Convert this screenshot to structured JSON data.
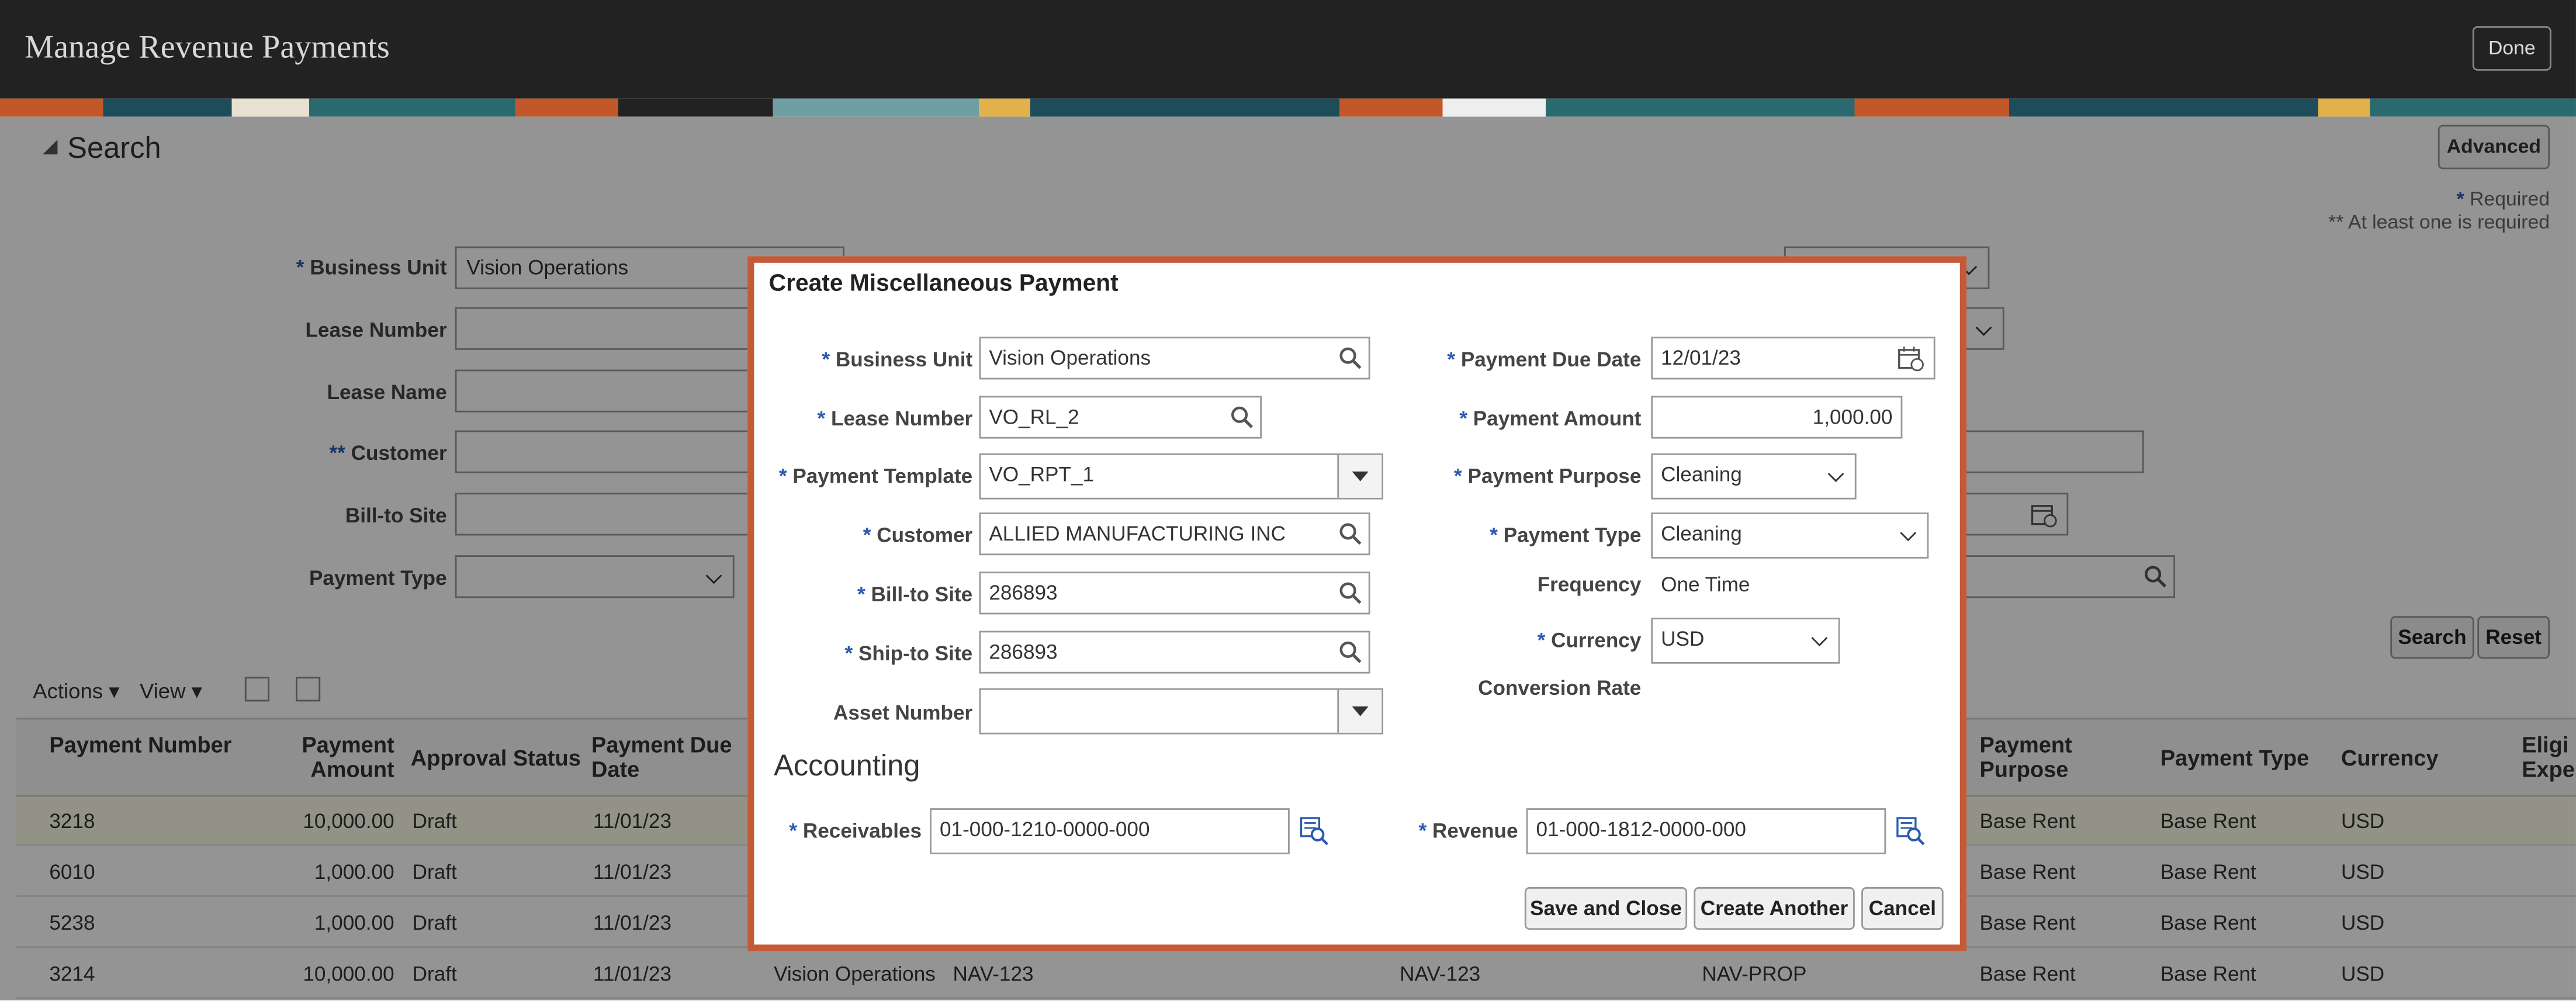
{
  "header": {
    "title": "Manage Revenue Payments",
    "done_label": "Done"
  },
  "search": {
    "title": "Search",
    "advanced_label": "Advanced",
    "required_note": "Required",
    "atleast_note": "** At least one is required",
    "fields": {
      "business_unit_label": "Business Unit",
      "business_unit_value": "Vision Operations",
      "lease_number_label": "Lease Number",
      "lease_name_label": "Lease Name",
      "customer_label": "Customer",
      "bill_to_site_label": "Bill-to Site",
      "payment_type_label": "Payment Type"
    },
    "search_label": "Search",
    "reset_label": "Reset"
  },
  "toolbar": {
    "actions_label": "Actions",
    "view_label": "View"
  },
  "table": {
    "columns": {
      "payment_number": "Payment Number",
      "payment_amount": "Payment Amount",
      "approval_status": "Approval Status",
      "payment_due_date": "Payment Due Date",
      "payment_purpose": "Payment Purpose",
      "payment_type": "Payment Type",
      "currency": "Currency",
      "eligible_expense": "Eligi Expe"
    },
    "rows": [
      {
        "number": "3218",
        "amount": "10,000.00",
        "status": "Draft",
        "due": "11/01/23",
        "bu": "",
        "lease": "",
        "lease2": "",
        "prop": "",
        "purpose": "Base Rent",
        "type": "Base Rent",
        "currency": "USD"
      },
      {
        "number": "6010",
        "amount": "1,000.00",
        "status": "Draft",
        "due": "11/01/23",
        "bu": "",
        "lease": "",
        "lease2": "",
        "prop": "",
        "purpose": "Base Rent",
        "type": "Base Rent",
        "currency": "USD"
      },
      {
        "number": "5238",
        "amount": "1,000.00",
        "status": "Draft",
        "due": "11/01/23",
        "bu": "",
        "lease": "",
        "lease2": "",
        "prop": "",
        "purpose": "Base Rent",
        "type": "Base Rent",
        "currency": "USD"
      },
      {
        "number": "3214",
        "amount": "10,000.00",
        "status": "Draft",
        "due": "11/01/23",
        "bu": "Vision Operations",
        "lease": "NAV-123",
        "lease2": "NAV-123",
        "prop": "NAV-PROP",
        "purpose": "Base Rent",
        "type": "Base Rent",
        "currency": "USD"
      }
    ]
  },
  "dialog": {
    "title": "Create Miscellaneous Payment",
    "business_unit_label": "Business Unit",
    "business_unit_value": "Vision Operations",
    "lease_number_label": "Lease Number",
    "lease_number_value": "VO_RL_2",
    "payment_template_label": "Payment Template",
    "payment_template_value": "VO_RPT_1",
    "customer_label": "Customer",
    "customer_value": "ALLIED MANUFACTURING INC",
    "bill_to_site_label": "Bill-to Site",
    "bill_to_site_value": "286893",
    "ship_to_site_label": "Ship-to Site",
    "ship_to_site_value": "286893",
    "asset_number_label": "Asset Number",
    "asset_number_value": "",
    "payment_due_date_label": "Payment Due Date",
    "payment_due_date_value": "12/01/23",
    "payment_amount_label": "Payment Amount",
    "payment_amount_value": "1,000.00",
    "payment_purpose_label": "Payment Purpose",
    "payment_purpose_value": "Cleaning",
    "payment_type_label": "Payment Type",
    "payment_type_value": "Cleaning",
    "frequency_label": "Frequency",
    "frequency_value": "One Time",
    "currency_label": "Currency",
    "currency_value": "USD",
    "conversion_rate_label": "Conversion Rate",
    "accounting_title": "Accounting",
    "receivables_label": "Receivables",
    "receivables_value": "01-000-1210-0000-000",
    "revenue_label": "Revenue",
    "revenue_value": "01-000-1812-0000-000",
    "save_close_label": "Save and Close",
    "create_another_label": "Create Another",
    "cancel_label": "Cancel"
  },
  "colors": {
    "accent": "#c55a36",
    "required_star": "#2a5bb0",
    "header_bg": "#222222"
  }
}
